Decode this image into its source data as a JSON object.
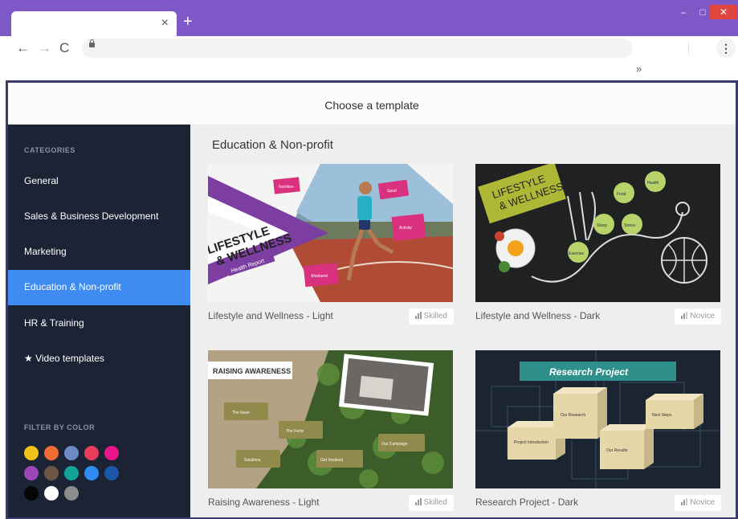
{
  "browser": {
    "tab_close": "×",
    "new_tab": "+",
    "back": "←",
    "forward": "→",
    "reload": "C",
    "menu": "⋮",
    "bookmarks_overflow": "»",
    "minimize": "‒",
    "maximize": "□",
    "close": "✕"
  },
  "app": {
    "title": "Choose a template"
  },
  "sidebar": {
    "categories_heading": "CATEGORIES",
    "items": [
      {
        "label": "General",
        "active": false
      },
      {
        "label": "Sales & Business Development",
        "active": false
      },
      {
        "label": "Marketing",
        "active": false
      },
      {
        "label": "Education & Non-profit",
        "active": true
      },
      {
        "label": "HR & Training",
        "active": false
      },
      {
        "label": "★ Video templates",
        "active": false
      }
    ],
    "filter_heading": "FILTER BY COLOR",
    "colors": [
      "#f2c21b",
      "#f06b33",
      "#6f89c8",
      "#ea3b5a",
      "#e8168a",
      "#9b47b6",
      "#6e5644",
      "#14a39a",
      "#2f8cf2",
      "#1c56a8",
      "#050505",
      "#ffffff",
      "#8c8c8c"
    ]
  },
  "main": {
    "section_title": "Education & Non-profit",
    "cards": [
      {
        "title": "Lifestyle and Wellness - Light",
        "level": "Skilled",
        "art_text": [
          "LIFESTYLE",
          "& WELLNESS",
          "Health Report"
        ],
        "tags": [
          "Nutrition",
          "Sport",
          "Activity",
          "Weekend"
        ]
      },
      {
        "title": "Lifestyle and Wellness - Dark",
        "level": "Novice",
        "art_text": [
          "LIFESTYLE",
          "& WELLNESS"
        ],
        "tags": [
          "Food",
          "Sleep",
          "Stress",
          "Exercise",
          "Health"
        ]
      },
      {
        "title": "Raising Awareness - Light",
        "level": "Skilled",
        "art_text": [
          "RAISING AWARENESS"
        ],
        "tags": [
          "The Issue",
          "The Facts",
          "Solutions",
          "Our Campaign",
          "Get Involved"
        ]
      },
      {
        "title": "Research Project - Dark",
        "level": "Novice",
        "art_text": [
          "Research Project"
        ],
        "tags": [
          "Project Introduction",
          "Our Research",
          "Our Results",
          "Next Steps"
        ]
      }
    ]
  }
}
